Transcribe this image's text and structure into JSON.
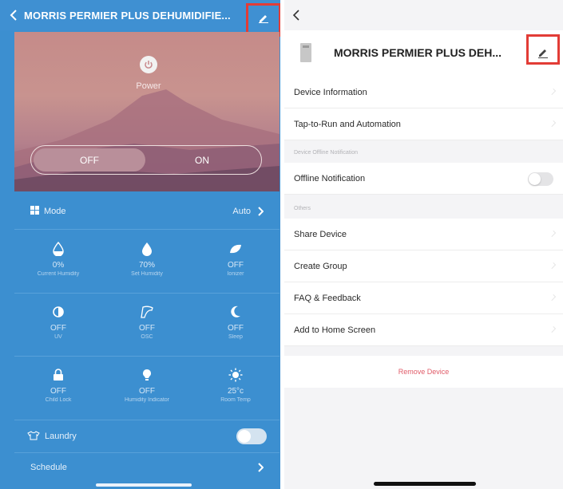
{
  "left": {
    "header_title": "MORRIS PERMIER PLUS DEHUMIDIFIE...",
    "power_label": "Power",
    "switch": {
      "off_label": "OFF",
      "on_label": "ON",
      "active": "OFF"
    },
    "mode": {
      "label": "Mode",
      "value": "Auto"
    },
    "tiles": [
      {
        "icon": "droplet-half-icon",
        "value": "0%",
        "name": "Current Humidity"
      },
      {
        "icon": "droplet-icon",
        "value": "70%",
        "name": "Set Humidity"
      },
      {
        "icon": "leaf-icon",
        "value": "OFF",
        "name": "Ionizer"
      },
      {
        "icon": "shield-half-icon",
        "value": "OFF",
        "name": "UV"
      },
      {
        "icon": "swing-icon",
        "value": "OFF",
        "name": "OSC"
      },
      {
        "icon": "moon-icon",
        "value": "OFF",
        "name": "Sleep"
      },
      {
        "icon": "lock-icon",
        "value": "OFF",
        "name": "Child Lock"
      },
      {
        "icon": "bulb-icon",
        "value": "OFF",
        "name": "Humidity Indicator"
      },
      {
        "icon": "sun-icon",
        "value": "25°c",
        "name": "Room Temp"
      }
    ],
    "laundry_label": "Laundry",
    "laundry_on": false,
    "schedule_label": "Schedule"
  },
  "right": {
    "device_title": "MORRIS PERMIER PLUS DEH...",
    "items_top": [
      "Device Information",
      "Tap-to-Run and Automation"
    ],
    "section_offline": "Device Offline Notification",
    "offline_label": "Offline Notification",
    "offline_on": false,
    "section_others": "Others",
    "items_others": [
      "Share Device",
      "Create Group",
      "FAQ & Feedback",
      "Add to Home Screen"
    ],
    "remove_label": "Remove Device"
  },
  "colors": {
    "left_bg": "#3c8fd0",
    "highlight": "#e23c36",
    "remove": "#e05b68"
  }
}
